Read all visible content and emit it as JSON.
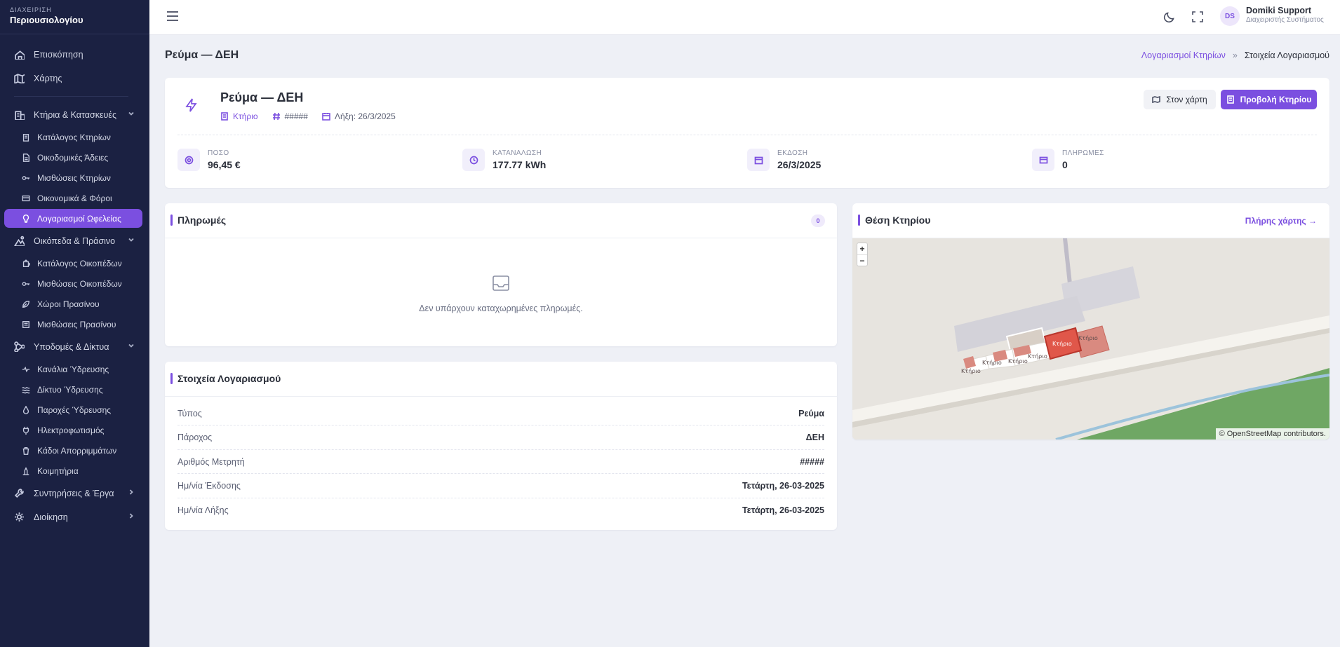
{
  "brand": {
    "small": "ΔΙΑΧΕΙΡΙΣΗ",
    "big": "Περιουσιολογίου"
  },
  "sidebar": {
    "top": [
      {
        "label": "Επισκόπηση",
        "icon": "home-icon"
      },
      {
        "label": "Χάρτης",
        "icon": "map-icon"
      }
    ],
    "groups": [
      {
        "label": "Κτήρια & Κατασκευές",
        "icon": "building-icon",
        "expanded": true,
        "items": [
          {
            "label": "Κατάλογος Κτηρίων",
            "icon": "building-small-icon"
          },
          {
            "label": "Οικοδομικές Άδειες",
            "icon": "document-icon"
          },
          {
            "label": "Μισθώσεις Κτηρίων",
            "icon": "key-icon"
          },
          {
            "label": "Οικονομικά & Φόροι",
            "icon": "wallet-icon"
          },
          {
            "label": "Λογαριασμοί Ωφελείας",
            "icon": "bulb-icon",
            "active": true
          }
        ]
      },
      {
        "label": "Οικόπεδα & Πράσινο",
        "icon": "land-icon",
        "expanded": true,
        "items": [
          {
            "label": "Κατάλογος Οικοπέδων",
            "icon": "puzzle-icon"
          },
          {
            "label": "Μισθώσεις Οικοπέδων",
            "icon": "key-icon"
          },
          {
            "label": "Χώροι Πρασίνου",
            "icon": "leaf-icon"
          },
          {
            "label": "Μισθώσεις Πρασίνου",
            "icon": "list-icon"
          }
        ]
      },
      {
        "label": "Υποδομές & Δίκτυα",
        "icon": "network-icon",
        "expanded": true,
        "items": [
          {
            "label": "Κανάλια Ύδρευσης",
            "icon": "channel-icon"
          },
          {
            "label": "Δίκτυο Ύδρευσης",
            "icon": "waves-icon"
          },
          {
            "label": "Παροχές Ύδρευσης",
            "icon": "drop-icon"
          },
          {
            "label": "Ηλεκτροφωτισμός",
            "icon": "plug-icon"
          },
          {
            "label": "Κάδοι Απορριμμάτων",
            "icon": "trash-icon"
          },
          {
            "label": "Κοιμητήρια",
            "icon": "monument-icon"
          }
        ]
      },
      {
        "label": "Συντηρήσεις & Έργα",
        "icon": "wrench-icon",
        "expanded": false,
        "items": []
      },
      {
        "label": "Διοίκηση",
        "icon": "gear-icon",
        "expanded": false,
        "items": []
      }
    ]
  },
  "topbar": {
    "user_initials": "DS",
    "user_name": "Domiki Support",
    "user_role": "Διαχειριστής Συστήματος"
  },
  "page": {
    "title": "Ρεύμα — ΔΕΗ",
    "breadcrumb": {
      "link": "Λογαριασμοί Κτηρίων",
      "sep": "»",
      "current": "Στοιχεία Λογαριασμού"
    }
  },
  "summary": {
    "title": "Ρεύμα — ΔΕΗ",
    "building_link": "Κτήριο",
    "meter": "#####",
    "due": "Λήξη: 26/3/2025",
    "btn_map": "Στον χάρτη",
    "btn_view": "Προβολή Κτηρίου",
    "stats": [
      {
        "label": "ΠΟΣΟ",
        "value": "96,45 €",
        "icon": "target-icon"
      },
      {
        "label": "ΚΑΤΑΝΑΛΩΣΗ",
        "value": "177.77 kWh",
        "icon": "gauge-icon"
      },
      {
        "label": "ΕΚΔΟΣΗ",
        "value": "26/3/2025",
        "icon": "calendar-icon"
      },
      {
        "label": "ΠΛΗΡΩΜΕΣ",
        "value": "0",
        "icon": "card-icon"
      }
    ]
  },
  "payments": {
    "title": "Πληρωμές",
    "count": "0",
    "empty_text": "Δεν υπάρχουν καταχωρημένες πληρωμές."
  },
  "details": {
    "title": "Στοιχεία Λογαριασμού",
    "rows": [
      {
        "k": "Τύπος",
        "v": "Ρεύμα"
      },
      {
        "k": "Πάροχος",
        "v": "ΔΕΗ"
      },
      {
        "k": "Αριθμός Μετρητή",
        "v": "#####"
      },
      {
        "k": "Ημ/νία Έκδοσης",
        "v": "Τετάρτη, 26-03-2025"
      },
      {
        "k": "Ημ/νία Λήξης",
        "v": "Τετάρτη, 26-03-2025"
      }
    ]
  },
  "map": {
    "title": "Θέση Κτηρίου",
    "full_link": "Πλήρης χάρτης →",
    "zoom_in": "+",
    "zoom_out": "−",
    "attribution": "© OpenStreetMap contributors.",
    "building_label": "Κτήριο",
    "colors": {
      "highlight": "#e0574a",
      "building": "#d98a80",
      "water": "#9cc3db",
      "green": "#5a9a4f"
    }
  },
  "colors": {
    "accent": "#7b4fe0",
    "sidebar": "#1b2142"
  }
}
